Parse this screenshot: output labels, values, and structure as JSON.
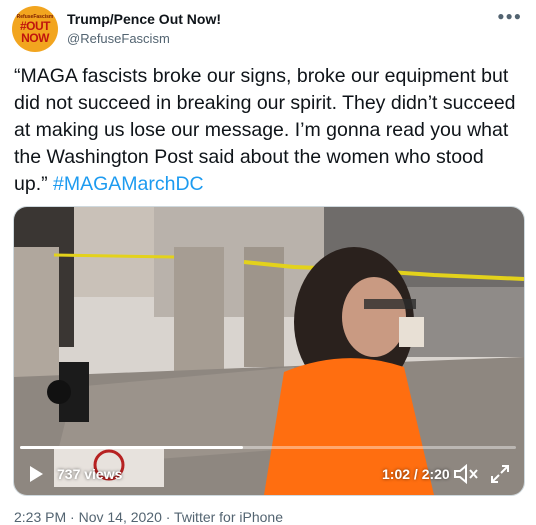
{
  "author": {
    "name": "Trump/Pence Out Now!",
    "handle": "@RefuseFascism",
    "avatar_text_small": "RefuseFascism",
    "avatar_text_1": "#OUT",
    "avatar_text_2": "NOW",
    "avatar_color": "#f2a51f"
  },
  "more_icon": "more-dots-icon",
  "tweet": {
    "text": "“MAGA fascists broke our signs, broke our equipment but did not succeed in breaking our spirit. They didn’t succeed at making us lose our message. I’m gonna read you what the Washington Post said about the women who stood up.” ",
    "hashtag": "#MAGAMarchDC",
    "hashtag_color": "#1d9bf0"
  },
  "video": {
    "views": "737 views",
    "time": "1:02 / 2:20",
    "progress": 0.45,
    "play_icon": "play-icon",
    "volume_icon": "volume-icon",
    "fullscreen_icon": "fullscreen-icon"
  },
  "meta": {
    "timestamp": "2:23 PM · Nov 14, 2020 · Twitter for iPhone"
  }
}
